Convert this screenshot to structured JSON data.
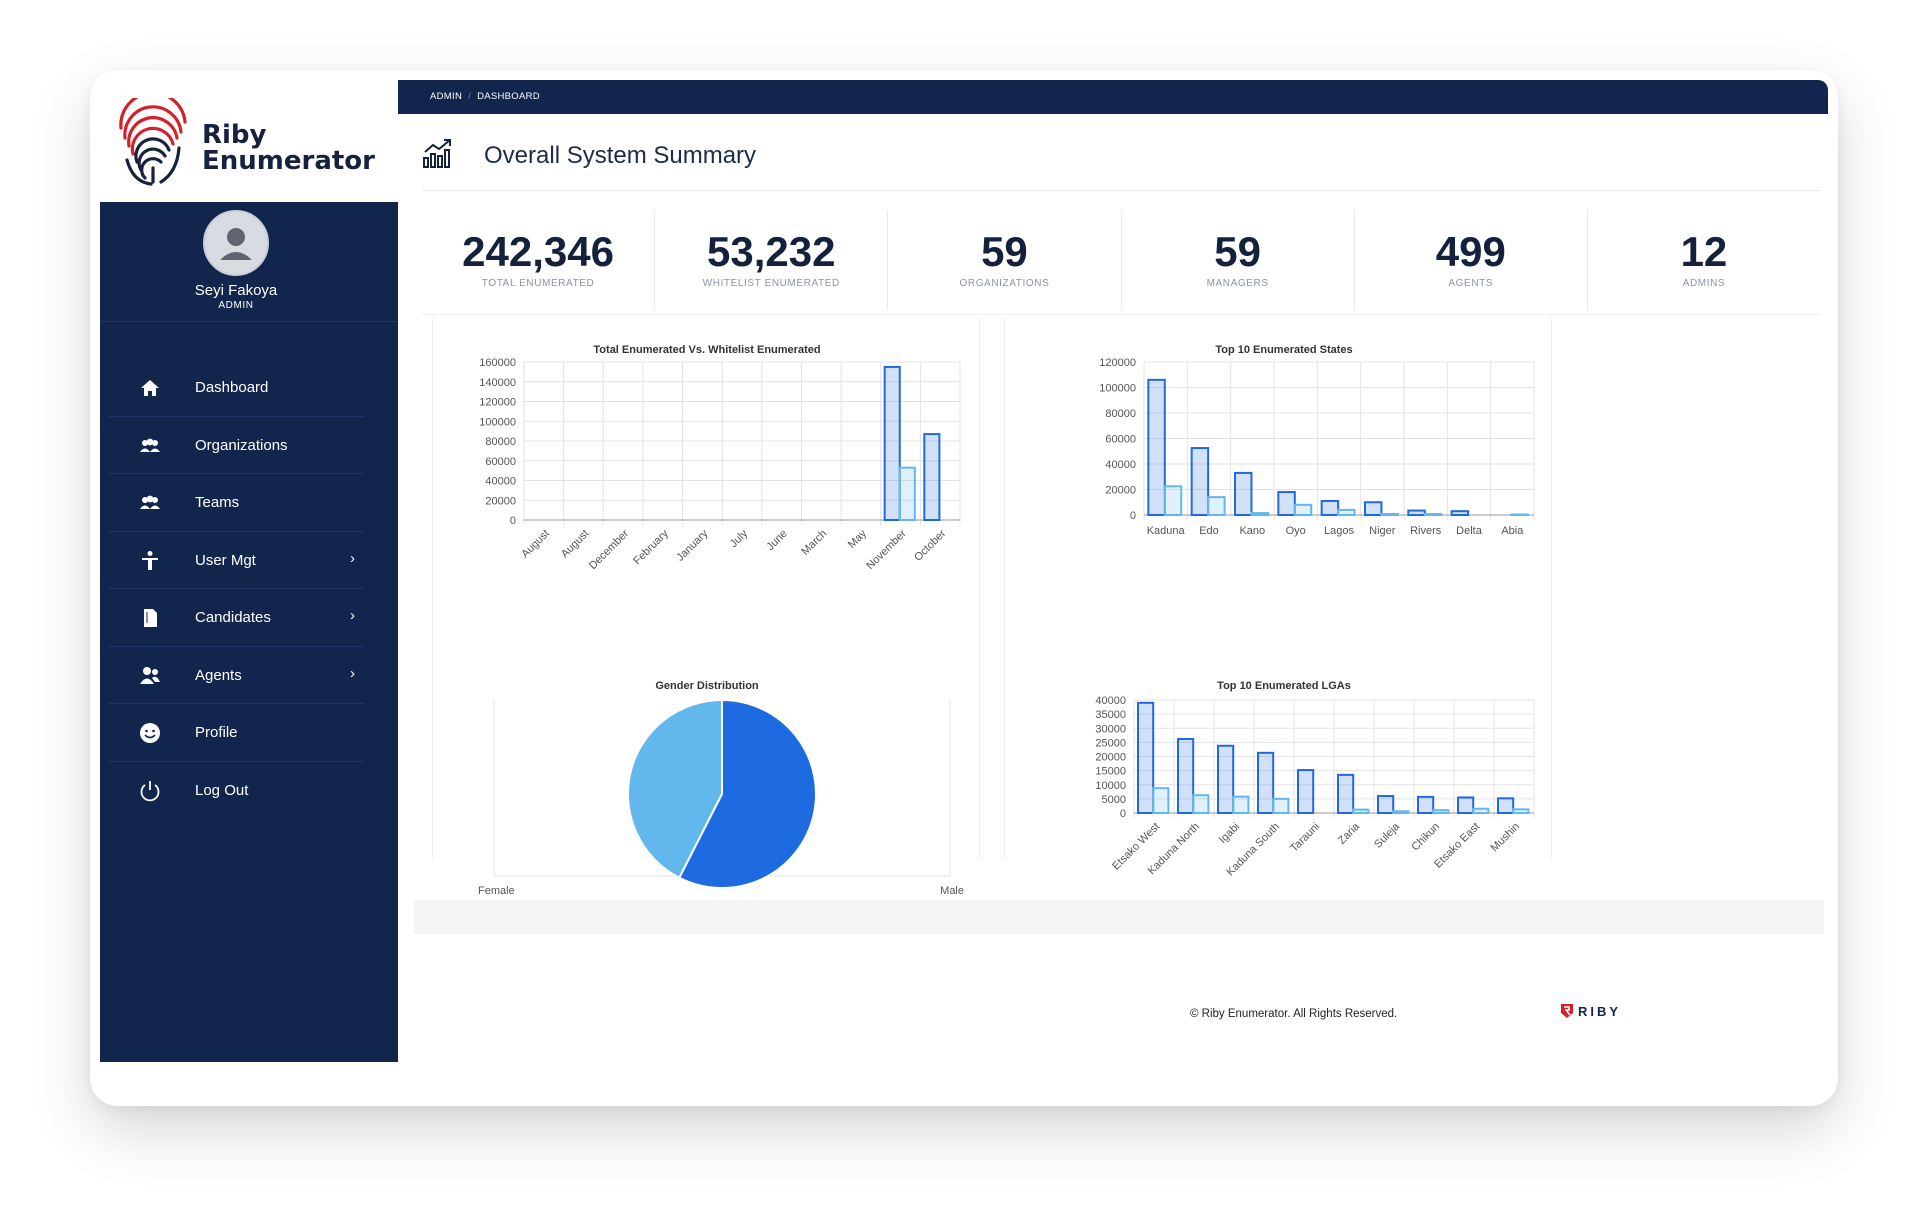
{
  "brand": {
    "line1": "Riby",
    "line2": "Enumerator"
  },
  "user": {
    "name": "Seyi Fakoya",
    "role": "ADMIN"
  },
  "nav": [
    {
      "label": "Dashboard",
      "icon": "home-icon",
      "chevron": ""
    },
    {
      "label": "Organizations",
      "icon": "users-group-icon",
      "chevron": ""
    },
    {
      "label": "Teams",
      "icon": "users-group-icon",
      "chevron": ""
    },
    {
      "label": "User Mgt",
      "icon": "person-icon",
      "chevron": "›"
    },
    {
      "label": "Candidates",
      "icon": "document-icon",
      "chevron": "›"
    },
    {
      "label": "Agents",
      "icon": "agents-icon",
      "chevron": "›"
    },
    {
      "label": "Profile",
      "icon": "smiley-icon",
      "chevron": ""
    },
    {
      "label": "Log Out",
      "icon": "power-icon",
      "chevron": ""
    }
  ],
  "breadcrumb": {
    "root": "ADMIN",
    "sep": "/",
    "current": "DASHBOARD"
  },
  "summary": {
    "title": "Overall System Summary",
    "icon": "chart-trend-icon"
  },
  "stats": [
    {
      "value": "242,346",
      "label": "TOTAL ENUMERATED"
    },
    {
      "value": "53,232",
      "label": "WHITELIST ENUMERATED"
    },
    {
      "value": "59",
      "label": "ORGANIZATIONS"
    },
    {
      "value": "59",
      "label": "MANAGERS"
    },
    {
      "value": "499",
      "label": "AGENTS"
    },
    {
      "value": "12",
      "label": "ADMINS"
    }
  ],
  "colors": {
    "navy": "#12264d",
    "series_dark": "#1e6ae1",
    "series_light": "#62b8ec"
  },
  "chart_data": [
    {
      "type": "bar",
      "title": "Total Enumerated Vs. Whitelist Enumerated",
      "categories": [
        "August",
        "August",
        "December",
        "February",
        "January",
        "July",
        "June",
        "March",
        "May",
        "November",
        "October"
      ],
      "ylim": [
        0,
        160000
      ],
      "yticks": [
        0,
        20000,
        40000,
        60000,
        80000,
        100000,
        120000,
        140000,
        160000
      ],
      "series": [
        {
          "values": [
            0,
            0,
            0,
            0,
            0,
            0,
            0,
            0,
            0,
            155000,
            87000
          ]
        },
        {
          "values": [
            0,
            0,
            0,
            0,
            0,
            0,
            0,
            0,
            0,
            53000,
            0
          ]
        }
      ]
    },
    {
      "type": "bar",
      "title": "Top 10 Enumerated States",
      "categories": [
        "Kaduna",
        "Edo",
        "Kano",
        "Oyo",
        "Lagos",
        "Niger",
        "Rivers",
        "Delta",
        "Abia"
      ],
      "ylim": [
        0,
        120000
      ],
      "yticks": [
        0,
        20000,
        40000,
        60000,
        80000,
        100000,
        120000
      ],
      "series": [
        {
          "values": [
            106000,
            52500,
            33000,
            18000,
            11000,
            10000,
            3500,
            3000,
            0
          ]
        },
        {
          "values": [
            22500,
            14000,
            1500,
            8000,
            4000,
            800,
            800,
            0,
            400
          ]
        }
      ]
    },
    {
      "type": "pie",
      "title": "Gender Distribution",
      "labels": [
        "Female",
        "Male"
      ],
      "values": [
        42.5,
        57.5
      ]
    },
    {
      "type": "bar",
      "title": "Top 10 Enumerated LGAs",
      "categories": [
        "Etsako West",
        "Kaduna North",
        "Igabi",
        "Kaduna South",
        "Tarauni",
        "Zaria",
        "Suleja",
        "Chikun",
        "Etsako East",
        "Mushin"
      ],
      "ylim": [
        0,
        40000
      ],
      "yticks": [
        0,
        5000,
        10000,
        15000,
        20000,
        25000,
        30000,
        35000,
        40000
      ],
      "series": [
        {
          "values": [
            39000,
            26200,
            23800,
            21300,
            15200,
            13500,
            6000,
            5700,
            5500,
            5200
          ]
        },
        {
          "values": [
            8800,
            6300,
            5800,
            5000,
            0,
            1200,
            600,
            1000,
            1500,
            1300
          ]
        }
      ]
    }
  ],
  "footer": {
    "text": "© Riby Enumerator. All Rights Reserved.",
    "logo": "RIBY"
  }
}
